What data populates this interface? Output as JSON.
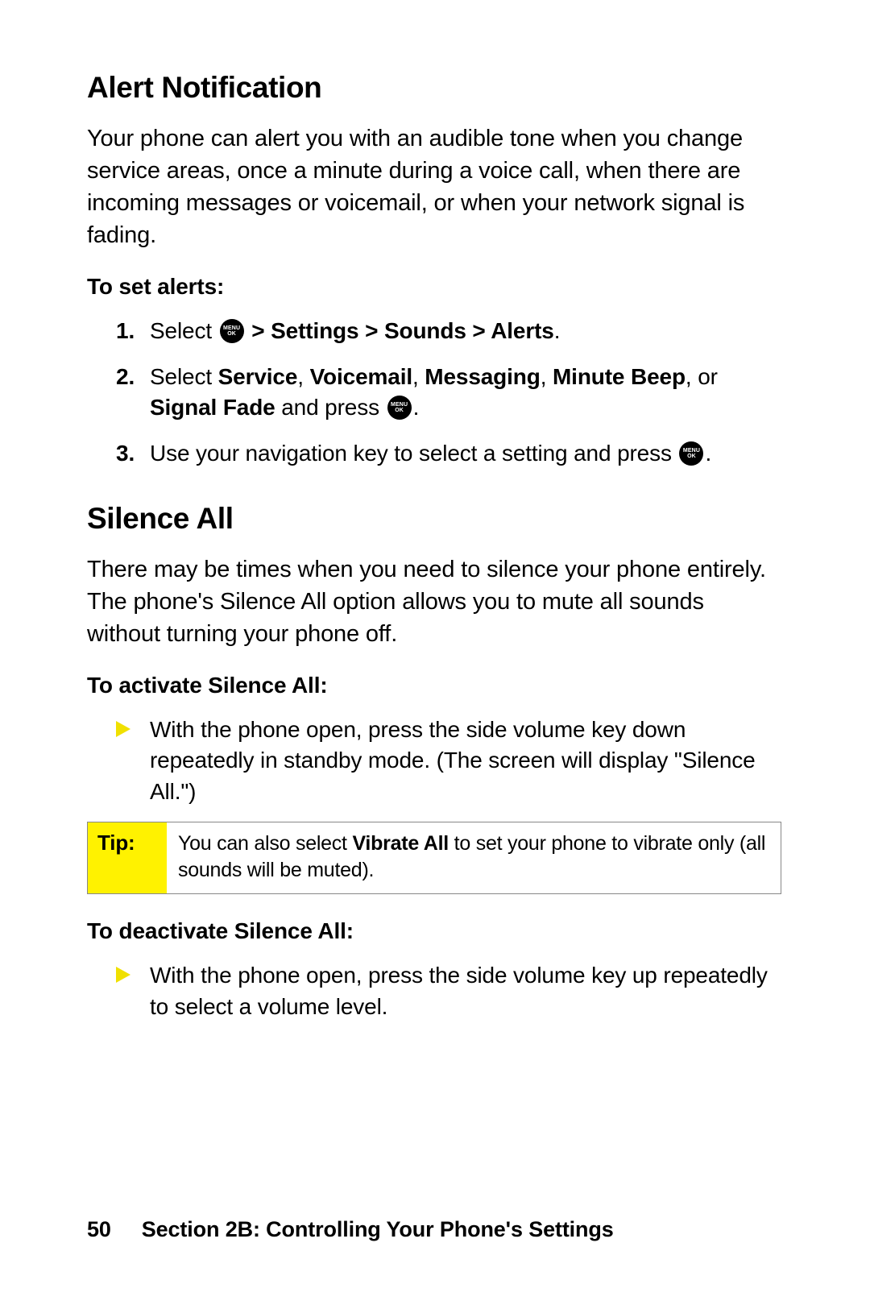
{
  "heading1": "Alert Notification",
  "intro1": "Your phone can alert you with an audible tone when you change service areas, once a minute during a voice call, when there are incoming messages or voicemail, or when your network signal is fading.",
  "subhead1": "To set alerts:",
  "step1_prefix": "Select ",
  "step1_path": " > Settings > Sounds > Alerts",
  "step1_suffix": ".",
  "step2_prefix": "Select ",
  "step2_opt1": "Service",
  "step2_c1": ", ",
  "step2_opt2": "Voicemail",
  "step2_c2": ", ",
  "step2_opt3": "Messaging",
  "step2_c3": ", ",
  "step2_opt4": "Minute Beep",
  "step2_c4": ", or ",
  "step2_opt5": "Signal Fade",
  "step2_and": " and press ",
  "step2_suffix": ".",
  "step3_prefix": "Use your navigation key to select a setting and press ",
  "step3_suffix": ".",
  "heading2": "Silence All",
  "intro2": "There may be times when you need to silence your phone entirely. The phone's Silence All option allows you to mute all sounds without turning your phone off.",
  "subhead2": "To activate Silence All:",
  "bullet1": "With the phone open, press the side volume key down repeatedly in standby mode. (The screen will display \"Silence All.\")",
  "tip_label": "Tip:",
  "tip_prefix": "You can also select ",
  "tip_bold": "Vibrate All",
  "tip_suffix": " to set your phone to vibrate only (all sounds will be muted).",
  "subhead3": "To deactivate Silence All:",
  "bullet2": "With the phone open, press the side volume key up repeatedly to select a volume level.",
  "page_num": "50",
  "footer_text": "Section 2B: Controlling Your Phone's Settings",
  "menu_top": "MENU",
  "menu_bot": "OK"
}
